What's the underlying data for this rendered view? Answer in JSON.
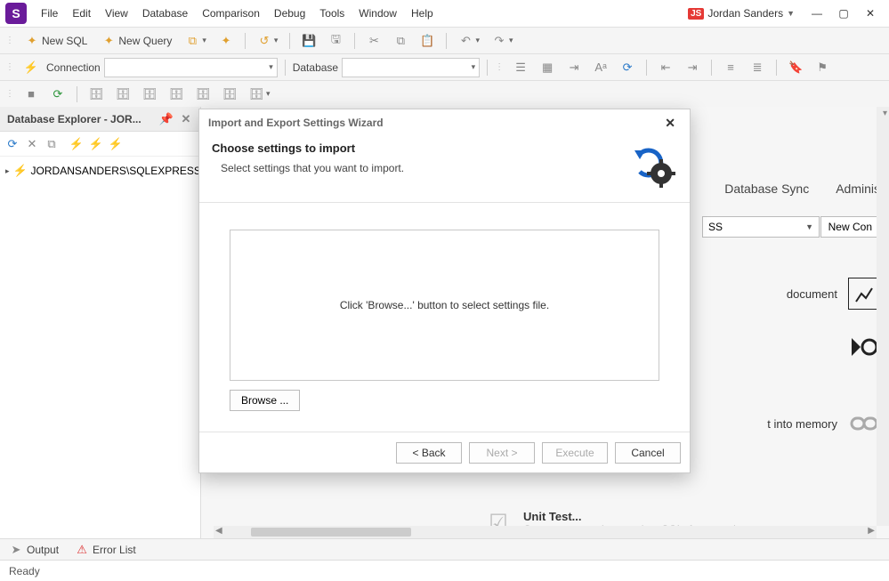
{
  "menubar": {
    "items": [
      "File",
      "Edit",
      "View",
      "Database",
      "Comparison",
      "Debug",
      "Tools",
      "Window",
      "Help"
    ],
    "user_initials": "JS",
    "user_name": "Jordan Sanders"
  },
  "toolbar1": {
    "new_sql": "New SQL",
    "new_query": "New Query"
  },
  "toolbar2": {
    "connection_label": "Connection",
    "connection_value": "",
    "database_label": "Database",
    "database_value": ""
  },
  "sidebar": {
    "title": "Database Explorer - JOR...",
    "tree_root": "JORDANSANDERS\\SQLEXPRESS"
  },
  "start": {
    "combo_value": "SS",
    "newcon_label": "New Con",
    "tab_dbsync": "Database Sync",
    "tab_admin": "Adminis",
    "doc_label": "document",
    "mem_label": "t into memory",
    "unit_title": "Unit Test...",
    "unit_sub": "Create a new unit test using tSQLt framework"
  },
  "wizard": {
    "title": "Import and Export Settings Wizard",
    "heading": "Choose settings to import",
    "sub": "Select settings that you want to import.",
    "filebox_hint": "Click 'Browse...' button to select settings file.",
    "browse": "Browse ...",
    "back": "< Back",
    "next": "Next >",
    "execute": "Execute",
    "cancel": "Cancel"
  },
  "bottom": {
    "output": "Output",
    "errorlist": "Error List"
  },
  "status": {
    "text": "Ready"
  }
}
